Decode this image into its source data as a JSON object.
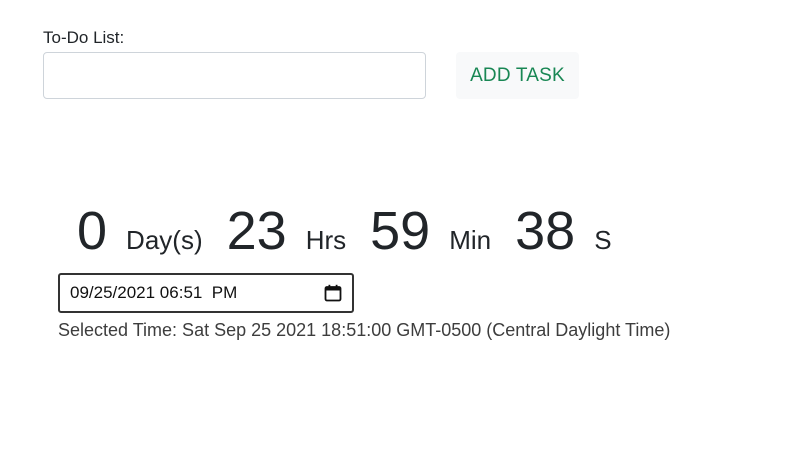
{
  "todo": {
    "label": "To-Do List:",
    "input_value": "",
    "add_button_label": "ADD TASK"
  },
  "countdown": {
    "days_value": "0",
    "days_unit": "Day(s)",
    "hours_value": "23",
    "hours_unit": "Hrs",
    "minutes_value": "59",
    "minutes_unit": "Min",
    "seconds_value": "38",
    "seconds_unit": "S"
  },
  "datetime_input": {
    "value": "09/25/2021 06:51  PM",
    "icon": "calendar-icon"
  },
  "selected_time": "Selected Time: Sat Sep 25 2021 18:51:00 GMT-0500 (Central Daylight Time)",
  "colors": {
    "add_button_text": "#198754",
    "add_button_bg": "#f8f9fa",
    "text": "#212529"
  }
}
